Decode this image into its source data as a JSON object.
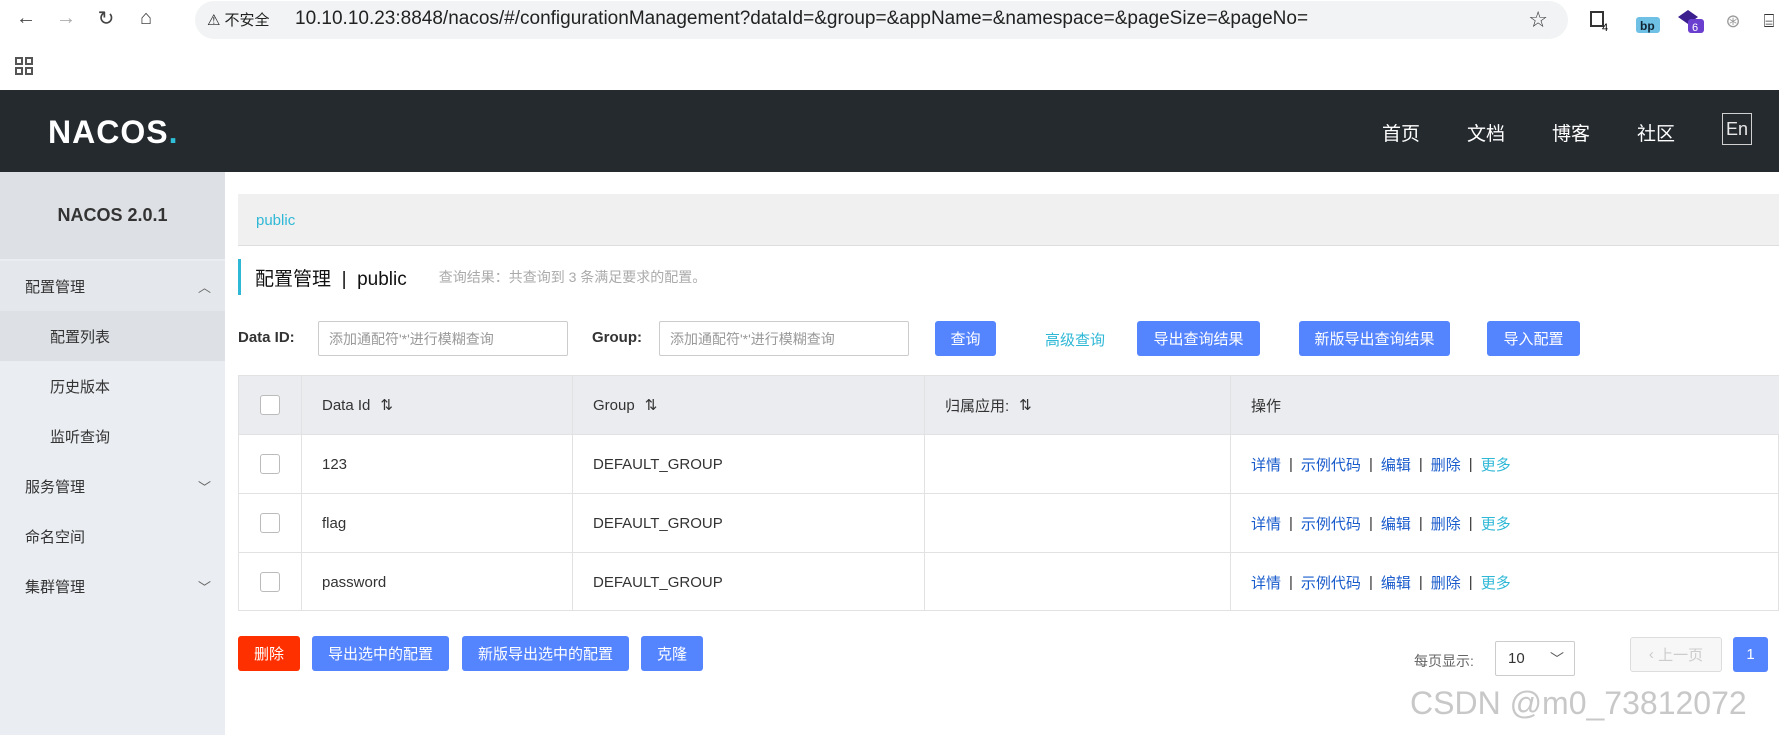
{
  "browser": {
    "security_label": "不安全",
    "url": "10.10.10.23:8848/nacos/#/configurationManagement?dataId=&group=&appName=&namespace=&pageSize=&pageNo=",
    "ext_badges": [
      "4",
      "bp",
      "6"
    ]
  },
  "header": {
    "logo": "NACOS",
    "logo_dot": ".",
    "nav": [
      "首页",
      "文档",
      "博客",
      "社区"
    ],
    "lang": "En"
  },
  "sidebar": {
    "version": "NACOS 2.0.1",
    "config_mgmt": "配置管理",
    "config_list": "配置列表",
    "history": "历史版本",
    "listen_query": "监听查询",
    "service_mgmt": "服务管理",
    "namespace": "命名空间",
    "cluster_mgmt": "集群管理"
  },
  "breadcrumb": "public",
  "page": {
    "title": "配置管理",
    "title_sep": "|",
    "namespace": "public",
    "result": "查询结果：共查询到 3 条满足要求的配置。"
  },
  "filters": {
    "dataid_label": "Data ID:",
    "dataid_placeholder": "添加通配符'*'进行模糊查询",
    "group_label": "Group:",
    "group_placeholder": "添加通配符'*'进行模糊查询",
    "query": "查询",
    "advanced": "高级查询",
    "export": "导出查询结果",
    "export_new": "新版导出查询结果",
    "import": "导入配置"
  },
  "table": {
    "columns": [
      "Data Id",
      "Group",
      "归属应用:",
      "操作"
    ],
    "sort_icon": "⇅",
    "rows": [
      {
        "data_id": "123",
        "group": "DEFAULT_GROUP",
        "app": ""
      },
      {
        "data_id": "flag",
        "group": "DEFAULT_GROUP",
        "app": ""
      },
      {
        "data_id": "password",
        "group": "DEFAULT_GROUP",
        "app": ""
      }
    ],
    "ops": {
      "detail": "详情",
      "sample": "示例代码",
      "edit": "编辑",
      "delete": "删除",
      "more": "更多",
      "sep": "|"
    }
  },
  "bottom": {
    "delete": "删除",
    "export_selected": "导出选中的配置",
    "export_selected_new": "新版导出选中的配置",
    "clone": "克隆",
    "per_page_label": "每页显示:",
    "per_page_value": "10",
    "prev": "上一页",
    "page": "1"
  },
  "watermark": "CSDN @m0_73812072",
  "colors": {
    "accent": "#5584ff",
    "link": "#2fb8d6",
    "danger": "#ff3000",
    "header_bg": "#252a2f"
  }
}
